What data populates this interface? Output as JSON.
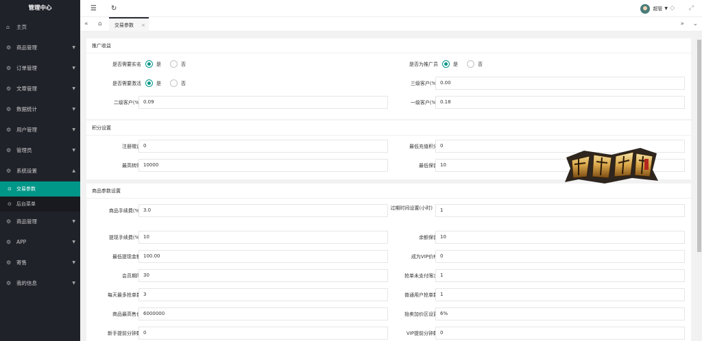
{
  "sidebar": {
    "title": "管理中心",
    "items": [
      {
        "label": "主页",
        "icon": "home-icon"
      },
      {
        "label": "商品管理",
        "icon": "settings-icon"
      },
      {
        "label": "订单管理",
        "icon": "settings-icon"
      },
      {
        "label": "文章管理",
        "icon": "settings-icon"
      },
      {
        "label": "数据统计",
        "icon": "settings-icon"
      },
      {
        "label": "用户管理",
        "icon": "settings-icon"
      },
      {
        "label": "管理员",
        "icon": "settings-icon"
      },
      {
        "label": "系统设置",
        "icon": "settings-icon"
      }
    ],
    "subitems": [
      {
        "label": "交易参数",
        "active": true
      },
      {
        "label": "后台菜单",
        "active": false
      }
    ],
    "items2": [
      {
        "label": "商品管理"
      },
      {
        "label": "APP"
      },
      {
        "label": "寄售"
      },
      {
        "label": "我的信息"
      }
    ]
  },
  "header": {
    "user_name": "超管"
  },
  "tabs": {
    "active_label": "交易参数"
  },
  "cards": {
    "promo": {
      "title": "推广收益",
      "need_realname_label": "是否需要实名",
      "is_promoter_label": "是否为推广员",
      "need_activate_label": "是否需要激活",
      "yes": "是",
      "no": "否",
      "level3_label": "三级客户(%)",
      "level3_value": "0.00",
      "level2_label": "二级客户(%)",
      "level2_value": "0.09",
      "level1_label": "一级客户(%)",
      "level1_value": "0.18"
    },
    "points": {
      "title": "积分设置",
      "reg_gift_label": "注册赠送",
      "reg_gift_value": "0",
      "min_recharge_label": "最低充值积分",
      "min_recharge_value": "0",
      "max_transfer_label": "最高转赠",
      "max_transfer_value": "10000",
      "min_keep_label": "最低保留",
      "min_keep_value": "10"
    },
    "goods": {
      "title": "商品参数设置",
      "fee_label": "商品手续费(%)",
      "fee_value": "3.0",
      "expire_label": "过期时间设置(小时)",
      "expire_value": "1",
      "withdraw_fee_label": "提现手续费(%)",
      "withdraw_fee_value": "10",
      "balance_keep_label": "余额保留",
      "balance_keep_value": "10",
      "min_withdraw_label": "最低提现金额",
      "min_withdraw_value": "100.00",
      "vip_price_label": "成为VIP价格",
      "vip_price_value": "0",
      "member_period_label": "会员期限",
      "member_period_value": "30",
      "unpaid_limit_label": "抢单未支付限次",
      "unpaid_limit_value": "1",
      "daily_max_label": "每天最多抢单数",
      "daily_max_value": "3",
      "normal_grab_label": "普通用户抢单数",
      "normal_grab_value": "1",
      "max_price_label": "商品最高售价",
      "max_price_value": "6000000",
      "markup_label": "抬卖加价区设置",
      "markup_value": "6%",
      "newbie_label": "新手提前分钟数",
      "newbie_value": "0",
      "vip_early_label": "VIP提前分钟数",
      "vip_early_value": "0"
    }
  },
  "watermark": {
    "logo_text": "南亚科技",
    "logo_small": "雷霆出品"
  },
  "colors": {
    "sidebar_bg": "#20222a",
    "accent": "#009688"
  }
}
